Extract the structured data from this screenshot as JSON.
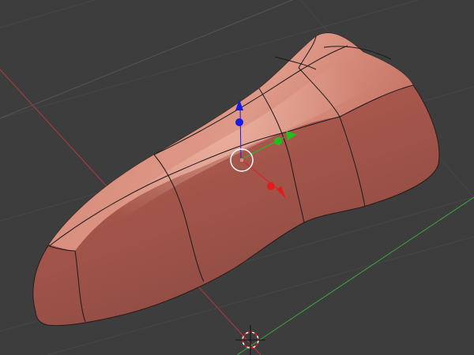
{
  "viewport": {
    "name": "3D Viewport",
    "background": "#3d3d3d",
    "grid_color": "#4a4a4a"
  },
  "axes": {
    "x_color": "#c23b3b",
    "y_color": "#4aa63a",
    "z_color": "#2f2fd6"
  },
  "object": {
    "shading": "smooth",
    "color": "#c96a5a",
    "wire_color": "#1a1a1a",
    "selected": true
  },
  "gizmo": {
    "type": "translate",
    "center_icon": "pivot-circle-icon",
    "x_handle_color": "#e31b1b",
    "y_handle_color": "#1fbf1f",
    "z_handle_color": "#1a1ae6"
  },
  "cursor": {
    "icon": "3d-cursor-icon"
  }
}
